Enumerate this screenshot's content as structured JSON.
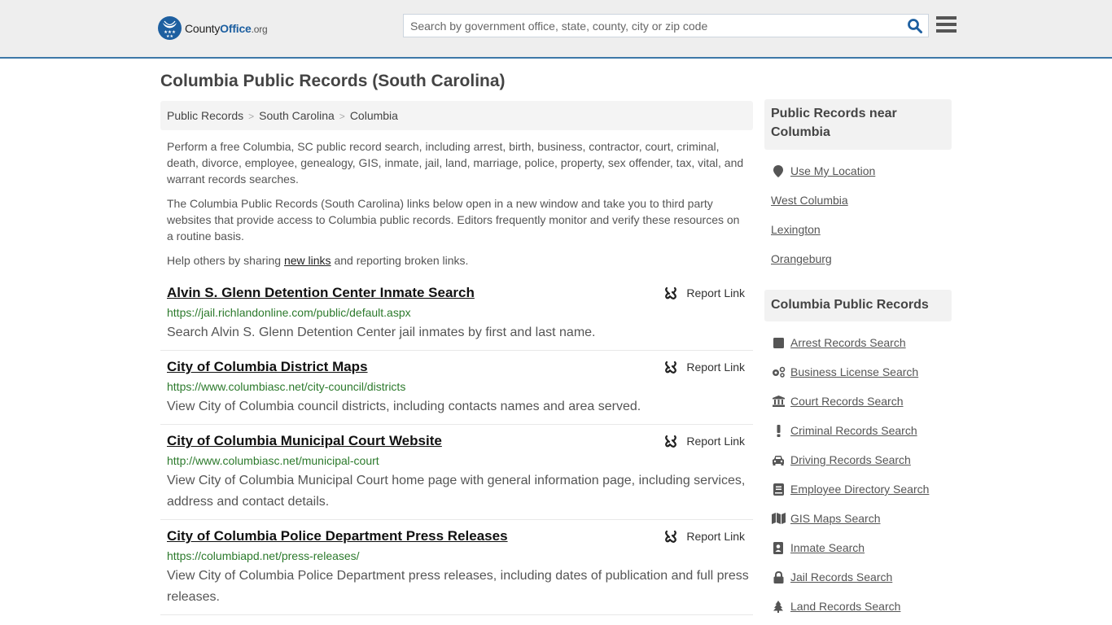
{
  "header": {
    "logo": {
      "county": "County",
      "office": "Office",
      "org": ".org"
    },
    "search": {
      "placeholder": "Search by government office, state, county, city or zip code",
      "value": ""
    },
    "search_icon": "search-icon",
    "menu_icon": "hamburger-menu-icon",
    "accent_color": "#3d78a8",
    "brand_color": "#1d5fa0"
  },
  "page": {
    "title": "Columbia Public Records (South Carolina)"
  },
  "breadcrumb": [
    {
      "label": "Public Records"
    },
    {
      "label": "South Carolina"
    },
    {
      "label": "Columbia"
    }
  ],
  "breadcrumb_sep": ">",
  "intro": {
    "p1": "Perform a free Columbia, SC public record search, including arrest, birth, business, contractor, court, criminal, death, divorce, employee, genealogy, GIS, inmate, jail, land, marriage, police, property, sex offender, tax, vital, and warrant records searches.",
    "p2": "The Columbia Public Records (South Carolina) links below open in a new window and take you to third party websites that provide access to Columbia public records. Editors frequently monitor and verify these resources on a routine basis.",
    "p3_before": "Help others by sharing ",
    "p3_link": "new links",
    "p3_after": " and reporting broken links."
  },
  "listings": [
    {
      "title": "Alvin S. Glenn Detention Center Inmate Search",
      "url": "https://jail.richlandonline.com/public/default.aspx",
      "description": "Search Alvin S. Glenn Detention Center jail inmates by first and last name.",
      "report_label": "Report Link"
    },
    {
      "title": "City of Columbia District Maps",
      "url": "https://www.columbiasc.net/city-council/districts",
      "description": "View City of Columbia council districts, including contacts names and area served.",
      "report_label": "Report Link"
    },
    {
      "title": "City of Columbia Municipal Court Website",
      "url": "http://www.columbiasc.net/municipal-court",
      "description": "View City of Columbia Municipal Court home page with general information page, including services, address and contact details.",
      "report_label": "Report Link"
    },
    {
      "title": "City of Columbia Police Department Press Releases",
      "url": "https://columbiapd.net/press-releases/",
      "description": "View City of Columbia Police Department press releases, including dates of publication and full press releases.",
      "report_label": "Report Link"
    }
  ],
  "sidebar": {
    "nearby": {
      "heading": "Public Records near Columbia",
      "use_location": {
        "label": "Use My Location",
        "icon": "map-marker-icon"
      },
      "places": [
        {
          "label": "West Columbia"
        },
        {
          "label": "Lexington"
        },
        {
          "label": "Orangeburg"
        }
      ]
    },
    "records": {
      "heading": "Columbia Public Records",
      "items": [
        {
          "label": "Arrest Records Search",
          "icon": "square-icon"
        },
        {
          "label": "Business License Search",
          "icon": "gears-icon"
        },
        {
          "label": "Court Records Search",
          "icon": "courthouse-icon"
        },
        {
          "label": "Criminal Records Search",
          "icon": "exclamation-icon"
        },
        {
          "label": "Driving Records Search",
          "icon": "car-icon"
        },
        {
          "label": "Employee Directory Search",
          "icon": "book-icon"
        },
        {
          "label": "GIS Maps Search",
          "icon": "map-icon"
        },
        {
          "label": "Inmate Search",
          "icon": "id-badge-icon"
        },
        {
          "label": "Jail Records Search",
          "icon": "lock-icon"
        },
        {
          "label": "Land Records Search",
          "icon": "tree-icon"
        }
      ]
    }
  }
}
